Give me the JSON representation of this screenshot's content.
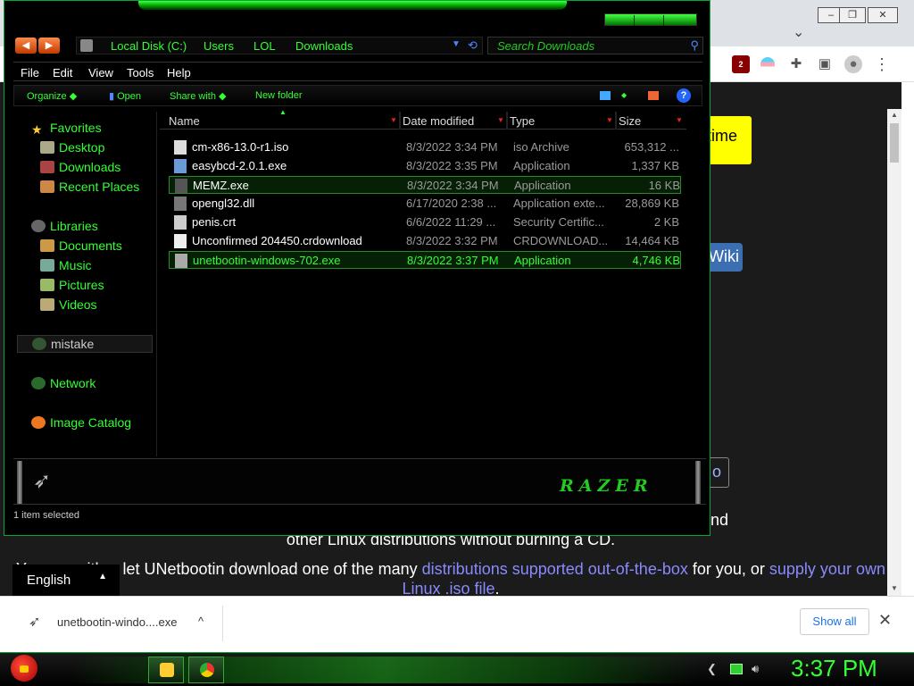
{
  "chrome": {
    "window_controls": [
      "–",
      "❐",
      "✕"
    ],
    "tab_chevron": "⌄",
    "extensions": [
      {
        "name": "ublock-origin-icon",
        "badge": "2"
      },
      {
        "name": "trans-flag-icon"
      },
      {
        "name": "puzzle-icon",
        "glyph": "✚"
      },
      {
        "name": "sidepanel-icon",
        "glyph": "▣"
      },
      {
        "name": "profile-avatar-icon",
        "glyph": "●"
      },
      {
        "name": "menu-icon",
        "glyph": "⋮"
      }
    ],
    "page": {
      "yellow_button_text": "time",
      "wiki_button_text": "Wiki",
      "boxed_button_text": "o",
      "trailing_text": "nd",
      "line1": "other Linux distributions without burning a CD.",
      "line2_a": "You can either let UNetbootin download one of the many ",
      "line2_link1": "distributions supported out-of-the-box",
      "line2_b": " for you, or ",
      "line2_link2": "supply your own Linux .iso file",
      "line2_c": ".",
      "language": "English",
      "language_caret": "▲"
    },
    "download_bar": {
      "item_name": "unetbootin-windo....exe",
      "item_caret": "^",
      "show_all": "Show all",
      "close": "✕"
    }
  },
  "explorer": {
    "nav_back": "◀",
    "nav_forward": "▶",
    "breadcrumb": [
      "Local Disk (C:)",
      "Users",
      "LOL",
      "Downloads"
    ],
    "search_placeholder": "Search Downloads",
    "menu": [
      "File",
      "Edit",
      "View",
      "Tools",
      "Help"
    ],
    "commands": {
      "organize": "Organize",
      "open": "Open",
      "share_with": "Share with",
      "new_folder": "New folder",
      "help": "?"
    },
    "nav": {
      "favorites": "Favorites",
      "desktop": "Desktop",
      "downloads": "Downloads",
      "recent_places": "Recent Places",
      "libraries": "Libraries",
      "documents": "Documents",
      "music": "Music",
      "pictures": "Pictures",
      "videos": "Videos",
      "mistake": "mistake",
      "network": "Network",
      "image_catalog": "Image Catalog"
    },
    "columns": [
      "Name",
      "Date modified",
      "Type",
      "Size"
    ],
    "files": [
      {
        "name": "cm-x86-13.0-r1.iso",
        "date": "8/3/2022 3:34 PM",
        "type": "iso Archive",
        "size": "653,312 ...",
        "icon_color": "#ddd"
      },
      {
        "name": "easybcd-2.0.1.exe",
        "date": "8/3/2022 3:35 PM",
        "type": "Application",
        "size": "1,337 KB",
        "icon_color": "#6a9ad8"
      },
      {
        "name": "MEMZ.exe",
        "date": "8/3/2022 3:34 PM",
        "type": "Application",
        "size": "16 KB",
        "icon_color": "#555"
      },
      {
        "name": "opengl32.dll",
        "date": "6/17/2020 2:38 ...",
        "type": "Application exte...",
        "size": "28,869 KB",
        "icon_color": "#777"
      },
      {
        "name": "penis.crt",
        "date": "6/6/2022 11:29 ...",
        "type": "Security Certific...",
        "size": "2 KB",
        "icon_color": "#ccc"
      },
      {
        "name": "Unconfirmed 204450.crdownload",
        "date": "8/3/2022 3:32 PM",
        "type": "CRDOWNLOAD...",
        "size": "14,464 KB",
        "icon_color": "#eee"
      },
      {
        "name": "unetbootin-windows-702.exe",
        "date": "8/3/2022 3:37 PM",
        "type": "Application",
        "size": "4,746 KB",
        "icon_color": "#aaa"
      }
    ],
    "brand": "RAZER",
    "status": "1 item selected"
  },
  "taskbar": {
    "clock": "3:37 PM"
  }
}
